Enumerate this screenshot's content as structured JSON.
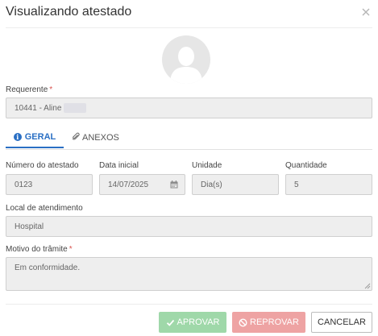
{
  "modal": {
    "title": "Visualizando atestado"
  },
  "requerente": {
    "label": "Requerente",
    "required": "*",
    "value": "10441 - Aline"
  },
  "tabs": [
    {
      "label": "GERAL",
      "icon": "info-icon",
      "active": true
    },
    {
      "label": "ANEXOS",
      "icon": "paperclip-icon",
      "active": false
    }
  ],
  "fields": {
    "numero": {
      "label": "Número do atestado",
      "value": "0123"
    },
    "data_inicial": {
      "label": "Data inicial",
      "value": "14/07/2025"
    },
    "unidade": {
      "label": "Unidade",
      "value": "Dia(s)"
    },
    "quantidade": {
      "label": "Quantidade",
      "value": "5"
    },
    "local": {
      "label": "Local de atendimento",
      "value": "Hospital"
    },
    "motivo": {
      "label": "Motivo do trâmite",
      "required": "*",
      "value": "Em conformidade."
    }
  },
  "buttons": {
    "aprovar": "APROVAR",
    "reprovar": "REPROVAR",
    "cancelar": "CANCELAR"
  },
  "colors": {
    "accent": "#2a6fc4",
    "approve": "#9fd8a9",
    "reject": "#eea3a3",
    "required": "#d9534f"
  }
}
